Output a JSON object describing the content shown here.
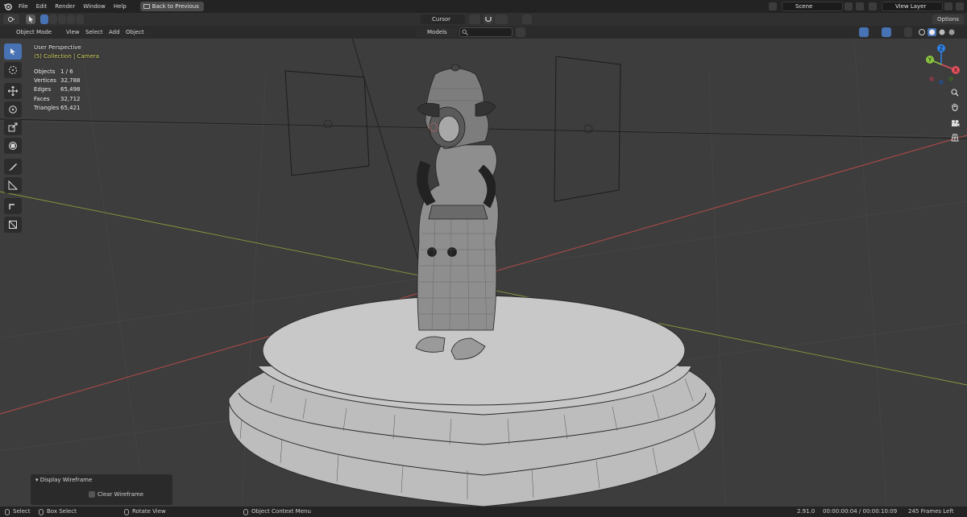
{
  "menu": {
    "items": [
      "File",
      "Edit",
      "Render",
      "Window",
      "Help"
    ],
    "back_button": "Back to Previous",
    "scene": "Scene",
    "view_layer": "View Layer"
  },
  "header": {
    "cursor": "Cursor",
    "options": "Options"
  },
  "row2": {
    "mode": "Object Mode",
    "view": "View",
    "select": "Select",
    "add": "Add",
    "object": "Object",
    "collection_filter": "Models"
  },
  "overlay": {
    "perspective": "User Perspective",
    "collection": "(5) Collection | Camera",
    "stats": [
      {
        "label": "Objects",
        "value": "1 / 6"
      },
      {
        "label": "Vertices",
        "value": "32,788"
      },
      {
        "label": "Edges",
        "value": "65,498"
      },
      {
        "label": "Faces",
        "value": "32,712"
      },
      {
        "label": "Triangles",
        "value": "65,421"
      }
    ]
  },
  "gizmo": {
    "x_label": "X",
    "y_label": "Y",
    "z_label": "Z",
    "x_color": "#e44f5c",
    "y_color": "#8bc43f",
    "z_color": "#2f83e6"
  },
  "operator_panel": {
    "title": "Display Wireframe",
    "checkbox_label": "Clear Wireframe"
  },
  "status": {
    "select": "Select",
    "box_select": "Box Select",
    "rotate_view": "Rotate View",
    "context_menu": "Object Context Menu",
    "version": "2.91.0",
    "time": "00:00:00:04 / 00:00:10:09",
    "frames_left": "245 Frames Left"
  },
  "colors": {
    "accent": "#4772b3",
    "viewport_bg": "#3d3d3d",
    "x_axis": "#b84a4a",
    "y_axis": "#8a9a3a"
  }
}
